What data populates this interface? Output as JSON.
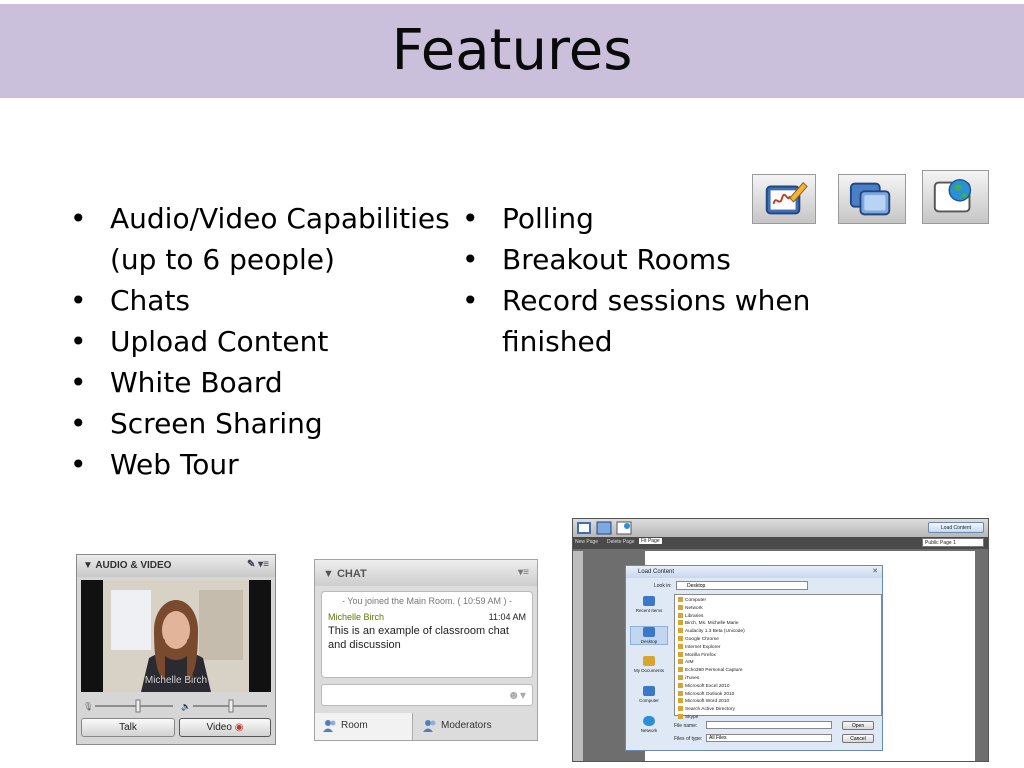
{
  "slide": {
    "title": "Features",
    "column1": [
      "Audio/Video Capabilities (up to 6 people)",
      "Chats",
      "Upload Content",
      "White Board",
      "Screen Sharing",
      "Web Tour"
    ],
    "column2": [
      "Polling",
      "Breakout Rooms",
      "Record sessions when finished"
    ],
    "tool_icons": [
      "whiteboard-icon",
      "screen-sharing-icon",
      "web-tour-icon"
    ],
    "colors": {
      "title_bar": "#cbc0dc",
      "accent_blue": "#3b78c8"
    }
  },
  "audio_video": {
    "header": "AUDIO & VIDEO",
    "participant_name": "Michelle Birch",
    "talk_button": "Talk",
    "video_button": "Video"
  },
  "chat": {
    "header": "CHAT",
    "system_message": "- You joined the Main Room. ( 10:59 AM ) -",
    "sender": "Michelle Birch",
    "time": "11:04 AM",
    "message": "This is an example of classroom chat and discussion",
    "tabs": [
      "Room",
      "Moderators"
    ]
  },
  "load_content": {
    "toolbar": [
      "New Page",
      "Delete Page",
      "Fit Page"
    ],
    "load_button": "Load Content",
    "page_select": "Public Page 1",
    "dialog_title": "Load Content",
    "look_in_label": "Look in:",
    "look_in_value": "Desktop",
    "places": [
      "Recent Items",
      "Desktop",
      "My Documents",
      "Computer",
      "Network"
    ],
    "files": [
      "Computer",
      "Network",
      "Libraries",
      "Birch, Ms. Michelle Marie",
      "Audacity 1.3 Beta (Unicode)",
      "Google Chrome",
      "Internet Explorer",
      "Mozilla Firefox",
      "AIM",
      "Echo360 Personal Capture",
      "iTunes",
      "Microsoft Excel 2010",
      "Microsoft Outlook 2010",
      "Microsoft Word 2010",
      "Search Active Directory",
      "Skype"
    ],
    "file_name_label": "File name:",
    "file_type_label": "Files of type:",
    "file_type_value": "All Files",
    "open_button": "Open",
    "cancel_button": "Cancel"
  }
}
